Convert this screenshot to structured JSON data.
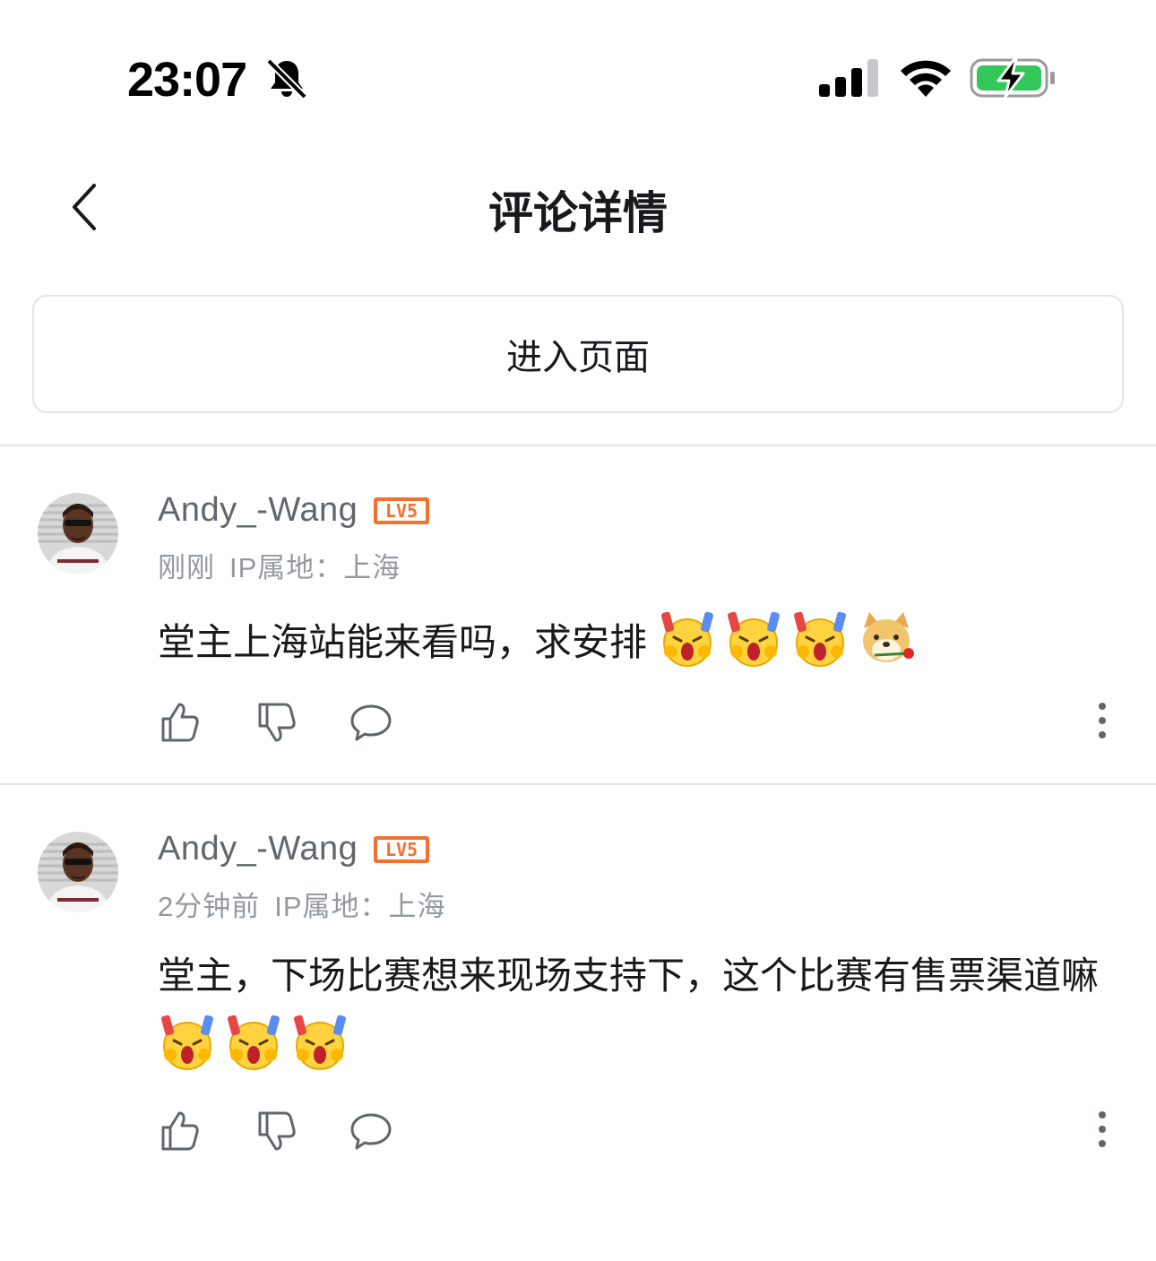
{
  "status_bar": {
    "time": "23:07",
    "icons": [
      "bell-off-icon",
      "cellular-signal-icon",
      "wifi-icon",
      "battery-charging-icon"
    ],
    "battery_color": "#34c759"
  },
  "header": {
    "title": "评论详情",
    "back_icon": "chevron-left-icon"
  },
  "enter_button": {
    "label": "进入页面"
  },
  "colors": {
    "level_badge": "#f3702f",
    "username": "#61666d",
    "meta": "#9499a0",
    "divider": "#e3e5e7"
  },
  "comments": [
    {
      "username": "Andy_-Wang",
      "level": "LV5",
      "time": "刚刚",
      "ip_location": "IP属地：上海",
      "text": "堂主上海站能来看吗，求安排",
      "emojis": [
        "fanatic-emoji",
        "fanatic-emoji",
        "fanatic-emoji",
        "doge-rose-emoji"
      ],
      "actions": [
        "thumbs-up-icon",
        "thumbs-down-icon",
        "reply-bubble-icon",
        "more-vertical-icon"
      ]
    },
    {
      "username": "Andy_-Wang",
      "level": "LV5",
      "time": "2分钟前",
      "ip_location": "IP属地：上海",
      "text": "堂主，下场比赛想来现场支持下，这个比赛有售票渠道嘛",
      "emojis": [
        "fanatic-emoji",
        "fanatic-emoji",
        "fanatic-emoji"
      ],
      "actions": [
        "thumbs-up-icon",
        "thumbs-down-icon",
        "reply-bubble-icon",
        "more-vertical-icon"
      ]
    }
  ]
}
